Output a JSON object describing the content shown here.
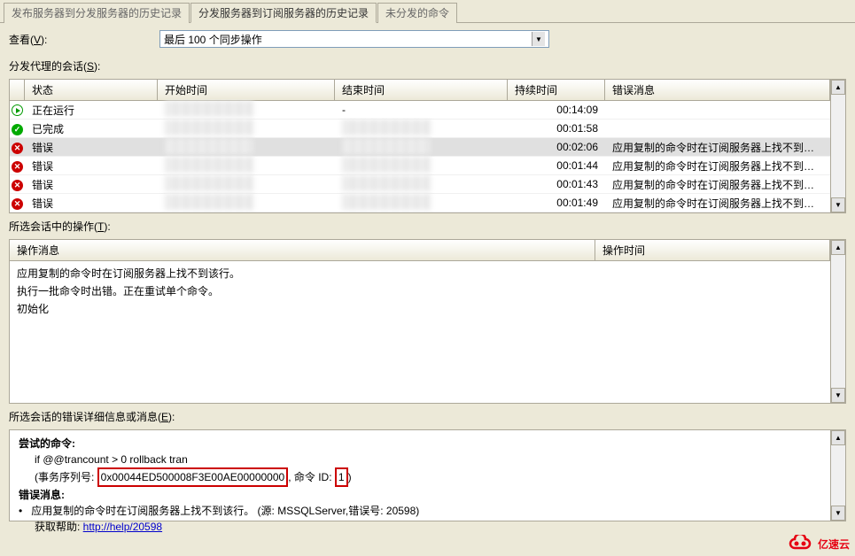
{
  "tabs": {
    "tab1": "发布服务器到分发服务器的历史记录",
    "tab2": "分发服务器到订阅服务器的历史记录",
    "tab3": "未分发的命令"
  },
  "view": {
    "label_prefix": "查看(",
    "label_key": "V",
    "label_suffix": "):",
    "selected": "最后 100 个同步操作"
  },
  "sessions": {
    "label_prefix": "分发代理的会话(",
    "label_key": "S",
    "label_suffix": "):",
    "headers": {
      "state": "状态",
      "start": "开始时间",
      "end": "结束时间",
      "duration": "持续时间",
      "error": "错误消息"
    },
    "rows": [
      {
        "icon": "running",
        "state": "正在运行",
        "end": "-",
        "duration": "00:14:09",
        "error": "",
        "selected": false
      },
      {
        "icon": "done",
        "state": "已完成",
        "end": "",
        "duration": "00:01:58",
        "error": "",
        "selected": false
      },
      {
        "icon": "error",
        "state": "错误",
        "end": "",
        "duration": "00:02:06",
        "error": "应用复制的命令时在订阅服务器上找不到…",
        "selected": true
      },
      {
        "icon": "error",
        "state": "错误",
        "end": "",
        "duration": "00:01:44",
        "error": "应用复制的命令时在订阅服务器上找不到…",
        "selected": false
      },
      {
        "icon": "error",
        "state": "错误",
        "end": "",
        "duration": "00:01:43",
        "error": "应用复制的命令时在订阅服务器上找不到…",
        "selected": false
      },
      {
        "icon": "error",
        "state": "错误",
        "end": "",
        "duration": "00:01:49",
        "error": "应用复制的命令时在订阅服务器上找不到…",
        "selected": false
      }
    ]
  },
  "ops": {
    "label_prefix": "所选会话中的操作(",
    "label_key": "T",
    "label_suffix": "):",
    "headers": {
      "msg": "操作消息",
      "time": "操作时间"
    },
    "rows": [
      "应用复制的命令时在订阅服务器上找不到该行。",
      "执行一批命令时出错。正在重试单个命令。",
      "初始化"
    ]
  },
  "detail": {
    "label_prefix": "所选会话的错误详细信息或消息(",
    "label_key": "E",
    "label_suffix": "):",
    "attempt_title": "尝试的命令:",
    "cmd_line": "if @@trancount > 0 rollback tran",
    "seq_label": "(事务序列号: ",
    "seq_value": "0x00044ED500008F3E00AE00000000",
    "cmd_id_label": " 命令 ID: ",
    "cmd_id_value": "1",
    "error_title": "错误消息:",
    "error_msg": "应用复制的命令时在订阅服务器上找不到该行。 (源: MSSQLServer,错误号: 20598)",
    "help_label": "获取帮助: ",
    "help_link": "http://help/20598"
  },
  "logo_text": "亿速云"
}
